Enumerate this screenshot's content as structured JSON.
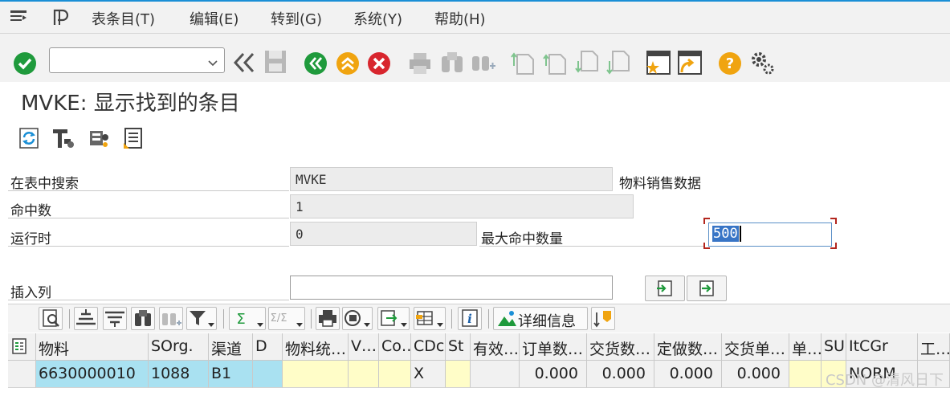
{
  "menu": {
    "items": [
      "表条目(T)",
      "编辑(E)",
      "转到(G)",
      "系统(Y)",
      "帮助(H)"
    ]
  },
  "toolbar": {
    "command_field": "",
    "icons": [
      "enter-icon",
      "back-icon",
      "save-icon",
      "back-green-icon",
      "exit-icon",
      "cancel-icon",
      "print-icon",
      "find-icon",
      "find-next-icon",
      "first-page-icon",
      "prev-page-icon",
      "next-page-icon",
      "last-page-icon",
      "create-session-icon",
      "shortcut-icon",
      "help-icon",
      "settings-icon"
    ]
  },
  "title": "MVKE: 显示找到的条目",
  "form": {
    "search_in_table_label": "在表中搜索",
    "search_in_table_value": "MVKE",
    "table_description": "物料销售数据",
    "hits_label": "命中数",
    "hits_value": "1",
    "runtime_label": "运行时",
    "runtime_value": "0",
    "max_hits_label": "最大命中数量",
    "max_hits_value": "500",
    "insert_column_label": "插入列",
    "insert_column_value": ""
  },
  "alv_toolbar": {
    "detail_label": "详细信息"
  },
  "grid": {
    "headers": [
      "物料",
      "SOrg.",
      "渠道",
      "D",
      "物料统…",
      "V…",
      "Co…",
      "CDc",
      "St",
      "有效…",
      "订单数…",
      "交货数…",
      "定做数…",
      "交货单…",
      "单…",
      "SU",
      "ItCGr",
      "工…"
    ],
    "rows": [
      [
        "6630000010",
        "1088",
        "B1",
        "",
        "",
        "",
        "",
        "X",
        "",
        "",
        "0.000",
        "0.000",
        "0.000",
        "0.000",
        "",
        "",
        "NORM",
        ""
      ]
    ]
  },
  "colors": {
    "key_cell": "#a9e1f1",
    "editable_cell": "#fffdc8",
    "accent": "#1a8fd6"
  },
  "watermark": "CSDN @清风日下"
}
